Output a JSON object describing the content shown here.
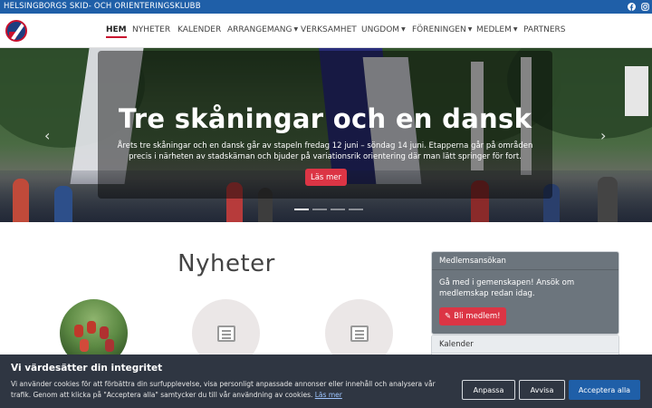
{
  "topbar": {
    "club_name": "HELSINGBORGS SKID- OCH ORIENTERINGSKLUBB",
    "social": [
      "facebook-icon",
      "instagram-icon"
    ]
  },
  "nav": {
    "items": [
      {
        "label": "HEM",
        "active": true,
        "dropdown": false
      },
      {
        "label": "NYHETER",
        "active": false,
        "dropdown": false
      },
      {
        "label": "KALENDER",
        "active": false,
        "dropdown": false
      },
      {
        "label": "ARRANGEMANG",
        "active": false,
        "dropdown": true
      },
      {
        "label": "VERKSAMHET",
        "active": false,
        "dropdown": false
      },
      {
        "label": "UNGDOM",
        "active": false,
        "dropdown": true
      },
      {
        "label": "FÖRENINGEN",
        "active": false,
        "dropdown": true
      },
      {
        "label": "MEDLEM",
        "active": false,
        "dropdown": true
      },
      {
        "label": "PARTNERS",
        "active": false,
        "dropdown": false
      }
    ]
  },
  "hero": {
    "title": "Tre skåningar och en dansk",
    "text": "Årets tre skåningar och en dansk går av stapeln fredag 12 juni – söndag 14 juni. Etapperna går på områden precis i närheten av stadskärnan och bjuder på variationsrik orientering där man lätt springer för fort.",
    "button": "Läs mer",
    "prev_icon": "‹",
    "next_icon": "›"
  },
  "news": {
    "heading": "Nyheter"
  },
  "sidebar": {
    "membership": {
      "title": "Medlemsansökan",
      "text": "Gå med i gemenskapen! Ansök om medlemskap redan idag.",
      "button": "Bli medlem!"
    },
    "calendar": {
      "title": "Kalender"
    }
  },
  "cookie": {
    "title": "Vi värdesätter din integritet",
    "text": "Vi använder cookies för att förbättra din surfupplevelse, visa personligt anpassade annonser eller innehåll och analysera vår trafik. Genom att klicka på \"Acceptera alla\" samtycker du till vår användning av cookies.",
    "link": "Läs mer",
    "customize": "Anpassa",
    "reject": "Avvisa",
    "accept": "Acceptera alla"
  },
  "colors": {
    "brand_blue": "#1f5fa8",
    "accent_red": "#dc3545",
    "cookie_bg": "#2f3642"
  }
}
